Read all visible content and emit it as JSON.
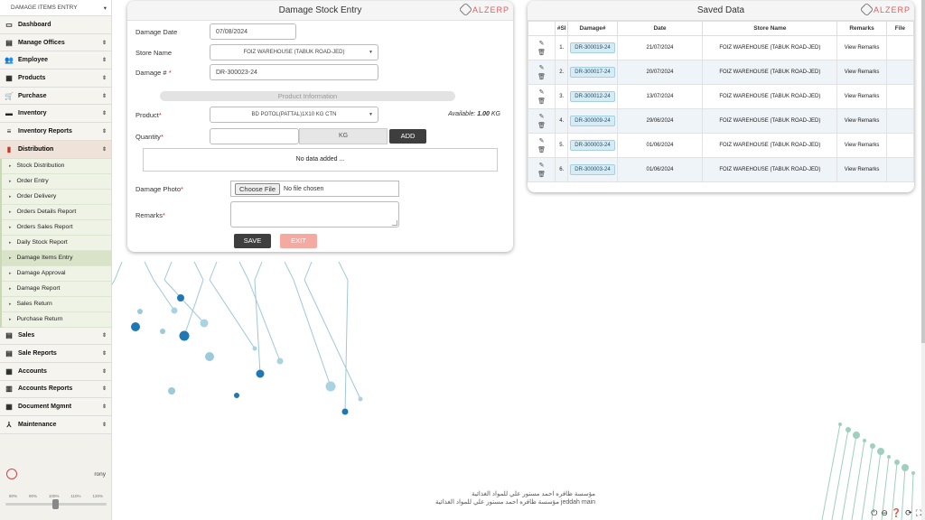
{
  "sidebar": {
    "page_select": "DAMAGE ITEMS ENTRY",
    "menu_top": [
      {
        "label": "Dashboard",
        "icon": "▭",
        "name": "dashboard"
      },
      {
        "label": "Manage Offices",
        "icon": "▤",
        "name": "manage-offices"
      },
      {
        "label": "Employee",
        "icon": "👥",
        "name": "employee"
      },
      {
        "label": "Products",
        "icon": "▦",
        "name": "products"
      },
      {
        "label": "Purchase",
        "icon": "🛒",
        "name": "purchase"
      },
      {
        "label": "Inventory",
        "icon": "▬",
        "name": "inventory"
      },
      {
        "label": "Inventory Reports",
        "icon": "≡",
        "name": "inventory-reports"
      },
      {
        "label": "Distribution",
        "icon": "▮",
        "name": "distribution"
      }
    ],
    "submenu": [
      "Stock Distribution",
      "Order Entry",
      "Order Delivery",
      "Orders Details Report",
      "Orders Sales Report",
      "Daily Stock Report",
      "Damage Items Entry",
      "Damage Approval",
      "Damage Report",
      "Sales Return",
      "Purchase Return"
    ],
    "menu_bottom": [
      {
        "label": "Sales",
        "icon": "▤",
        "name": "sales"
      },
      {
        "label": "Sale Reports",
        "icon": "▤",
        "name": "sale-reports"
      },
      {
        "label": "Accounts",
        "icon": "▦",
        "name": "accounts"
      },
      {
        "label": "Accounts Reports",
        "icon": "▥",
        "name": "accounts-reports"
      },
      {
        "label": "Document Mgmnt",
        "icon": "▦",
        "name": "document-mgmnt"
      },
      {
        "label": "Maintenance",
        "icon": "⅄",
        "name": "maintenance"
      }
    ],
    "user": "rony",
    "zoom_levels": [
      "80%",
      "90%",
      "100%",
      "110%",
      "120%"
    ],
    "zoom_value": "100%"
  },
  "entry_form": {
    "title": "Damage Stock Entry",
    "brand": "ALZERP",
    "damage_date_label": "Damage Date",
    "damage_date": "07/08/2024",
    "store_label": "Store Name",
    "store_value": "FOIZ WAREHOUSE (TABUK ROAD-JED)",
    "damage_no_label": "Damage #",
    "damage_no": "DR-300023-24",
    "product_info": "Product Information",
    "product_label": "Product",
    "product_value": "BD POTOL(PATTAL)1X10 KG CTN",
    "available_label": "Available:",
    "available_value": "1.00",
    "available_unit": "KG",
    "quantity_label": "Quantity",
    "unit": "KG",
    "add_label": "ADD",
    "no_data": "No data added ...",
    "photo_label": "Damage Photo",
    "choose_file": "Choose File",
    "no_file": "No file chosen",
    "remarks_label": "Remarks",
    "save_label": "SAVE",
    "exit_label": "EXIT"
  },
  "saved": {
    "title": "Saved Data",
    "brand": "ALZERP",
    "headers": [
      "",
      "#Sl",
      "Damage#",
      "Date",
      "Store Name",
      "Remarks",
      "File"
    ],
    "rows": [
      {
        "sl": "1.",
        "damage": "DR-300019-24",
        "date": "21/07/2024",
        "store": "FOIZ WAREHOUSE (TABUK ROAD-JED)",
        "remarks": "View Remarks",
        "file": ""
      },
      {
        "sl": "2.",
        "damage": "DR-300017-24",
        "date": "20/07/2024",
        "store": "FOIZ WAREHOUSE (TABUK ROAD-JED)",
        "remarks": "View Remarks",
        "file": ""
      },
      {
        "sl": "3.",
        "damage": "DR-300012-24",
        "date": "13/07/2024",
        "store": "FOIZ WAREHOUSE (TABUK ROAD-JED)",
        "remarks": "View Remarks",
        "file": ""
      },
      {
        "sl": "4.",
        "damage": "DR-300009-24",
        "date": "29/06/2024",
        "store": "FOIZ WAREHOUSE (TABUK ROAD-JED)",
        "remarks": "View Remarks",
        "file": ""
      },
      {
        "sl": "5.",
        "damage": "DR-300003-24",
        "date": "01/06/2024",
        "store": "FOIZ WAREHOUSE (TABUK ROAD-JED)",
        "remarks": "View Remarks",
        "file": ""
      },
      {
        "sl": "6.",
        "damage": "DR-300003-24",
        "date": "01/06/2024",
        "store": "FOIZ WAREHOUSE (TABUK ROAD-JED)",
        "remarks": "View Remarks",
        "file": ""
      }
    ]
  },
  "footer": {
    "line1": "مؤسسة ظافره احمد مستور علي للمواد الغذائية",
    "line2": "مؤسسة ظافره احمد مستور علي للمواد الغذائية jeddah main"
  },
  "colors": {
    "accent": "#3e3e3e",
    "exit": "#f4a9a1",
    "brand": "#e06060",
    "row_alt": "#eef4f8"
  }
}
